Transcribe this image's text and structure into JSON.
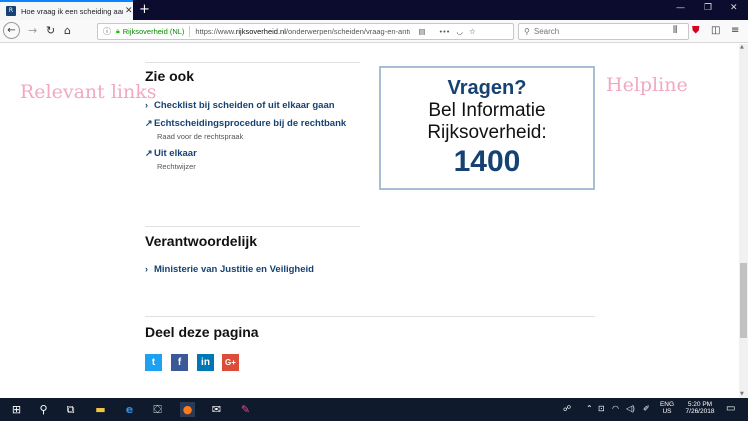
{
  "browser": {
    "tab_title": "Hoe vraag ik een scheiding aan?",
    "tab_close": "✕",
    "new_tab": "+",
    "url_identity": "Rijksoverheid (NL)",
    "url_prefix": "https://www.",
    "url_domain": "rijksoverheid.nl",
    "url_path": "/onderwerpen/scheiden/vraag-en-antwoord",
    "search_placeholder": "Search",
    "more_dots": "•••"
  },
  "annotations": {
    "left": "Relevant links",
    "right": "Helpline"
  },
  "zie_ook": {
    "heading": "Zie ook",
    "links": [
      {
        "label": "Checklist bij scheiden of uit elkaar gaan",
        "sub": "",
        "icon": "›"
      },
      {
        "label": "Echtscheidingsprocedure bij de rechtbank",
        "sub": "Raad voor de rechtspraak",
        "icon": "↗"
      },
      {
        "label": "Uit elkaar",
        "sub": "Rechtwijzer",
        "icon": "↗"
      }
    ]
  },
  "helpline": {
    "question": "Vragen?",
    "line1": "Bel Informatie",
    "line2": "Rijksoverheid:",
    "number": "1400"
  },
  "verantwoordelijk": {
    "heading": "Verantwoordelijk",
    "link": "Ministerie van Justitie en Veiligheid"
  },
  "share": {
    "heading": "Deel deze pagina",
    "twitter": "t",
    "facebook": "f",
    "linkedin": "in",
    "googleplus": "G+"
  },
  "taskbar": {
    "lang": "ENG",
    "region": "US",
    "time": "5:20 PM",
    "date": "7/26/2018"
  },
  "colors": {
    "link": "#154273",
    "annotation": "#f2a7c3",
    "twitter": "#1da1f2",
    "facebook": "#3b5998",
    "linkedin": "#0077b5",
    "googleplus": "#dd4b39"
  }
}
